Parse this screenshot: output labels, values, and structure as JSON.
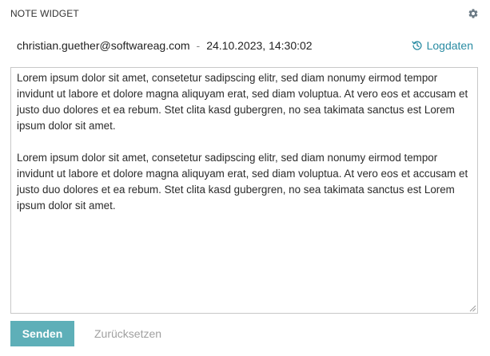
{
  "widget": {
    "title": "NOTE WIDGET",
    "settings_icon": "gear-icon"
  },
  "meta": {
    "email": "christian.guether@softwareag.com",
    "separator": "-",
    "datetime": "24.10.2023, 14:30:02",
    "logdaten_label": "Logdaten",
    "logdaten_icon": "history-icon",
    "accent_color": "#2a8ca3"
  },
  "note": {
    "paragraphs": [
      "Lorem ipsum dolor sit amet, consetetur sadipscing elitr, sed diam nonumy eirmod tempor invidunt ut labore et dolore magna aliquyam erat, sed diam voluptua. At vero eos et accusam et justo duo dolores et ea rebum. Stet clita kasd gubergren, no sea takimata sanctus est Lorem ipsum dolor sit amet.",
      "Lorem ipsum dolor sit amet, consetetur sadipscing elitr, sed diam nonumy eirmod tempor invidunt ut labore et dolore magna aliquyam erat, sed diam voluptua. At vero eos et accusam et justo duo dolores et ea rebum. Stet clita kasd gubergren, no sea takimata sanctus est Lorem ipsum dolor sit amet."
    ]
  },
  "actions": {
    "send_label": "Senden",
    "send_color": "#5eafb8",
    "reset_label": "Zurücksetzen"
  }
}
